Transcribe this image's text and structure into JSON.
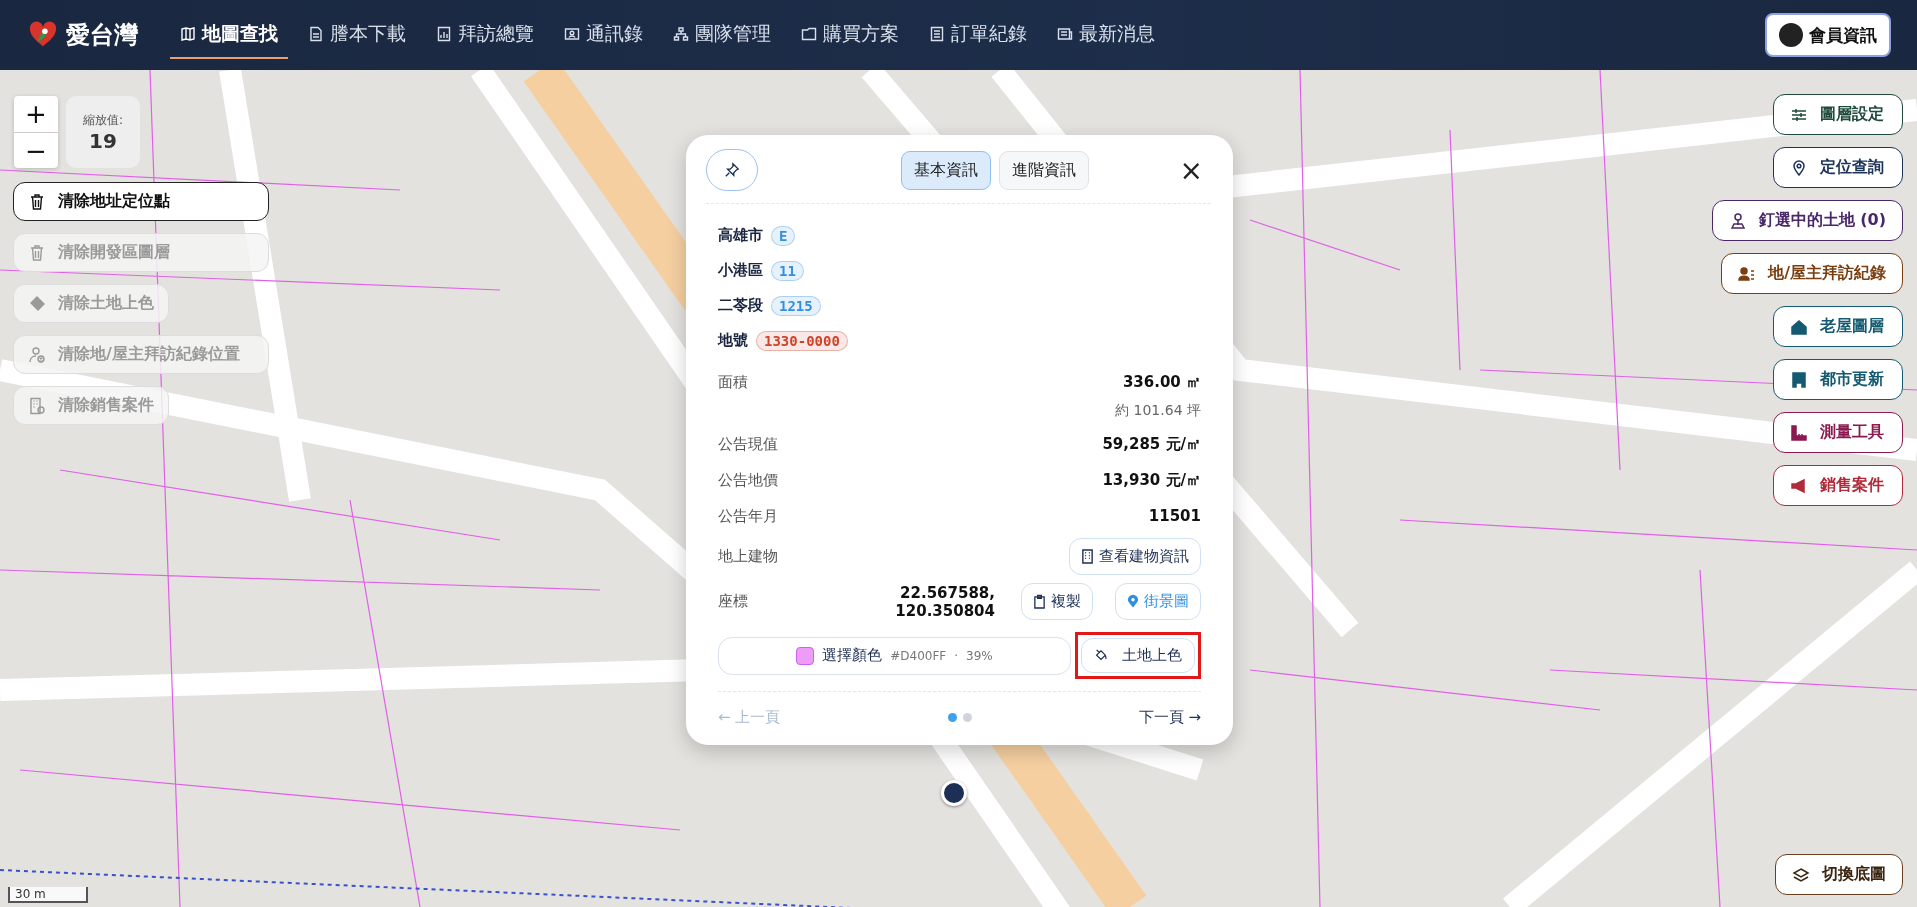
{
  "nav": {
    "logo": "愛台灣",
    "items": [
      {
        "label": "地圖查找",
        "selected": true
      },
      {
        "label": "謄本下載",
        "selected": false
      },
      {
        "label": "拜訪總覽",
        "selected": false
      },
      {
        "label": "通訊錄",
        "selected": false
      },
      {
        "label": "團隊管理",
        "selected": false
      },
      {
        "label": "購買方案",
        "selected": false
      },
      {
        "label": "訂單紀錄",
        "selected": false
      },
      {
        "label": "最新消息",
        "selected": false
      }
    ],
    "member_button": "會員資訊"
  },
  "zoom": {
    "plus": "+",
    "minus": "−",
    "label": "縮放值:",
    "value": "19"
  },
  "left_actions": [
    {
      "label": "清除地址定位點",
      "disabled": false
    },
    {
      "label": "清除開發區圖層",
      "disabled": true
    },
    {
      "label": "清除土地上色",
      "disabled": true
    },
    {
      "label": "清除地/屋主拜訪紀錄位置",
      "disabled": true
    },
    {
      "label": "清除銷售案件",
      "disabled": true
    }
  ],
  "right_actions": [
    {
      "label": "圖層設定",
      "color": "#1f4a3c"
    },
    {
      "label": "定位查詢",
      "color": "#1e3358"
    },
    {
      "label": "釘選中的土地 (0)",
      "color": "#4a2868"
    },
    {
      "label": "地/屋主拜訪紀錄",
      "color": "#7a3e10"
    },
    {
      "label": "老屋圖層",
      "color": "#145a70"
    },
    {
      "label": "都市更新",
      "color": "#145a70"
    },
    {
      "label": "測量工具",
      "color": "#8a1a50"
    },
    {
      "label": "銷售案件",
      "color": "#b02a3a"
    }
  ],
  "basemap_button": "切換底圖",
  "scale": "30 m",
  "popup": {
    "tabs": [
      {
        "label": "基本資訊",
        "selected": true
      },
      {
        "label": "進階資訊",
        "selected": false
      }
    ],
    "close": "×",
    "location": [
      {
        "label": "高雄市",
        "code": "E",
        "color": "#2f8fe0"
      },
      {
        "label": "小港區",
        "code": "11",
        "color": "#2f8fe0"
      },
      {
        "label": "二苓段",
        "code": "1215",
        "color": "#2f8fe0"
      },
      {
        "label": "地號",
        "code": "1330-0000",
        "color": "#d0432b"
      }
    ],
    "fields": [
      {
        "kind": "value",
        "label": "面積",
        "value": "336.00 ㎡",
        "sub": "約 101.64 坪"
      },
      {
        "kind": "value",
        "label": "公告現值",
        "value": "59,285 元/㎡"
      },
      {
        "kind": "value",
        "label": "公告地價",
        "value": "13,930 元/㎡"
      },
      {
        "kind": "value",
        "label": "公告年月",
        "value": "11501"
      },
      {
        "kind": "building",
        "label": "地上建物",
        "button": "查看建物資訊"
      },
      {
        "kind": "coords",
        "label": "座標",
        "value": "22.567588,\n120.350804",
        "copy": "複製",
        "street": "街景圖"
      }
    ],
    "color_picker": {
      "label": "選擇顏色",
      "hex": "#D400FF",
      "sep": "·",
      "opacity": "39%"
    },
    "paint_button": {
      "label": "土地上色",
      "highlighted": true
    },
    "prev": {
      "label": "← 上一頁",
      "disabled": true
    },
    "next": {
      "label": "下一頁 →",
      "disabled": false
    },
    "pages": [
      {
        "selected": true
      },
      {
        "selected": false
      }
    ]
  }
}
